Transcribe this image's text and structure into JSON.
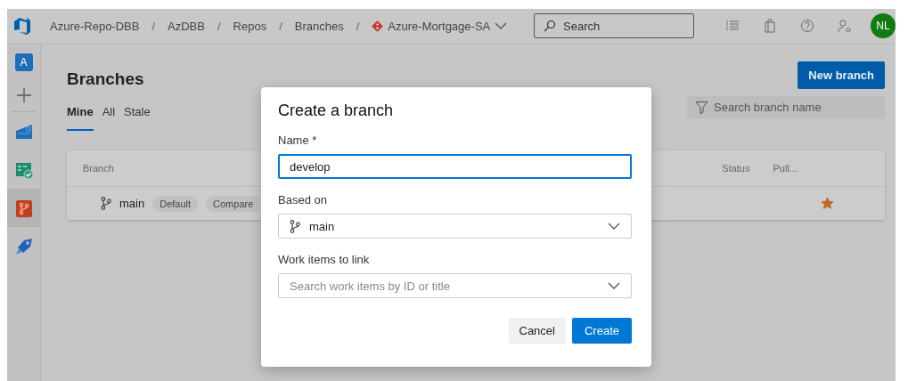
{
  "topbar": {
    "breadcrumb": [
      {
        "label": "Azure-Repo-DBB"
      },
      {
        "label": "AzDBB"
      },
      {
        "label": "Repos"
      },
      {
        "label": "Branches"
      }
    ],
    "separator": "/",
    "repo": {
      "label": "Azure-Mortgage-SA"
    },
    "search": {
      "placeholder": "Search"
    },
    "avatar": "NL"
  },
  "sidebar": {
    "project": "A",
    "items": [
      {
        "kind": "add",
        "selected": false
      },
      {
        "kind": "overview",
        "selected": false
      },
      {
        "kind": "boards",
        "selected": false
      },
      {
        "kind": "repos",
        "selected": true
      },
      {
        "kind": "pipelines",
        "selected": false
      }
    ]
  },
  "page": {
    "title": "Branches",
    "new_button": "New branch",
    "tabs": [
      {
        "label": "Mine",
        "selected": true
      },
      {
        "label": "All",
        "selected": false
      },
      {
        "label": "Stale",
        "selected": false
      }
    ],
    "filter": {
      "placeholder": "Search branch name"
    },
    "table": {
      "columns": [
        "Branch",
        "Status",
        "Pull..."
      ],
      "rows": [
        {
          "name": "main",
          "tags": [
            "Default",
            "Compare"
          ],
          "favorite": true
        }
      ]
    }
  },
  "dialog": {
    "title": "Create a branch",
    "fields": [
      {
        "kind": "text",
        "label": "Name *",
        "value": "develop",
        "focused": true
      },
      {
        "kind": "branch",
        "label": "Based on",
        "value": "main"
      },
      {
        "kind": "search",
        "label": "Work items to link",
        "placeholder": "Search work items by ID or title"
      }
    ],
    "buttons": [
      {
        "label": "Cancel",
        "primary": false
      },
      {
        "label": "Create",
        "primary": true
      }
    ]
  }
}
